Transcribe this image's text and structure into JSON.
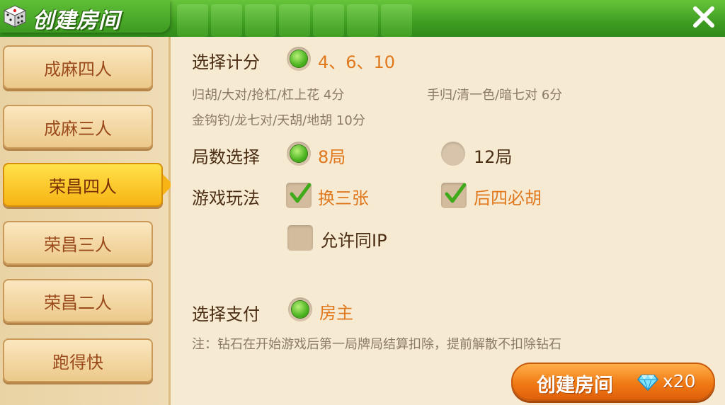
{
  "header": {
    "title": "创建房间",
    "close_icon": "close-icon"
  },
  "sidebar": {
    "tabs": [
      {
        "label": "成麻四人",
        "active": false
      },
      {
        "label": "成麻三人",
        "active": false
      },
      {
        "label": "荣昌四人",
        "active": true
      },
      {
        "label": "荣昌三人",
        "active": false
      },
      {
        "label": "荣昌二人",
        "active": false
      },
      {
        "label": "跑得快",
        "active": false
      }
    ]
  },
  "score": {
    "label": "选择计分",
    "option": "4、6、10",
    "desc1a": "归胡/大对/抢杠/杠上花 4分",
    "desc1b": "手归/清一色/暗七对 6分",
    "desc2": "金钩钓/龙七对/天胡/地胡 10分"
  },
  "rounds": {
    "label": "局数选择",
    "opt1": "8局",
    "opt2": "12局",
    "selected": "8局"
  },
  "rules": {
    "label": "游戏玩法",
    "opt1": "换三张",
    "opt2": "后四必胡",
    "opt3": "允许同IP",
    "opt1_checked": true,
    "opt2_checked": true,
    "opt3_checked": false
  },
  "payment": {
    "label": "选择支付",
    "option": "房主",
    "note": "注：钻石在开始游戏后第一局牌局结算扣除，提前解散不扣除钻石"
  },
  "create": {
    "label": "创建房间",
    "cost": "x20",
    "diamond_icon": "diamond-icon"
  },
  "colors": {
    "accent": "#e0781e",
    "header_green": "#3f9d22",
    "active_tab": "#f7b414"
  }
}
